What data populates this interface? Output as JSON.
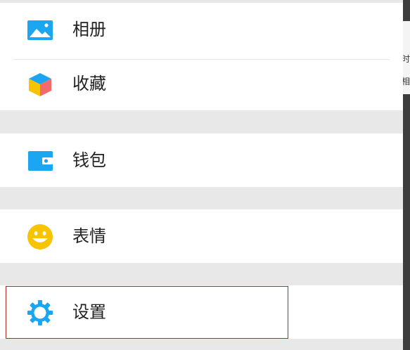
{
  "menu": {
    "items": [
      {
        "label": "相册",
        "icon": "album-icon"
      },
      {
        "label": "收藏",
        "icon": "favorites-cube-icon"
      },
      {
        "label": "钱包",
        "icon": "wallet-icon"
      },
      {
        "label": "表情",
        "icon": "emoji-smile-icon"
      },
      {
        "label": "设置",
        "icon": "settings-gear-icon"
      }
    ]
  },
  "side_fragments": [
    "时",
    "相"
  ],
  "colors": {
    "accent_blue": "#1aa6f0",
    "emoji_yellow": "#f6c400",
    "section_gap": "#e8e8e8",
    "highlight_border": "#b3262a"
  }
}
